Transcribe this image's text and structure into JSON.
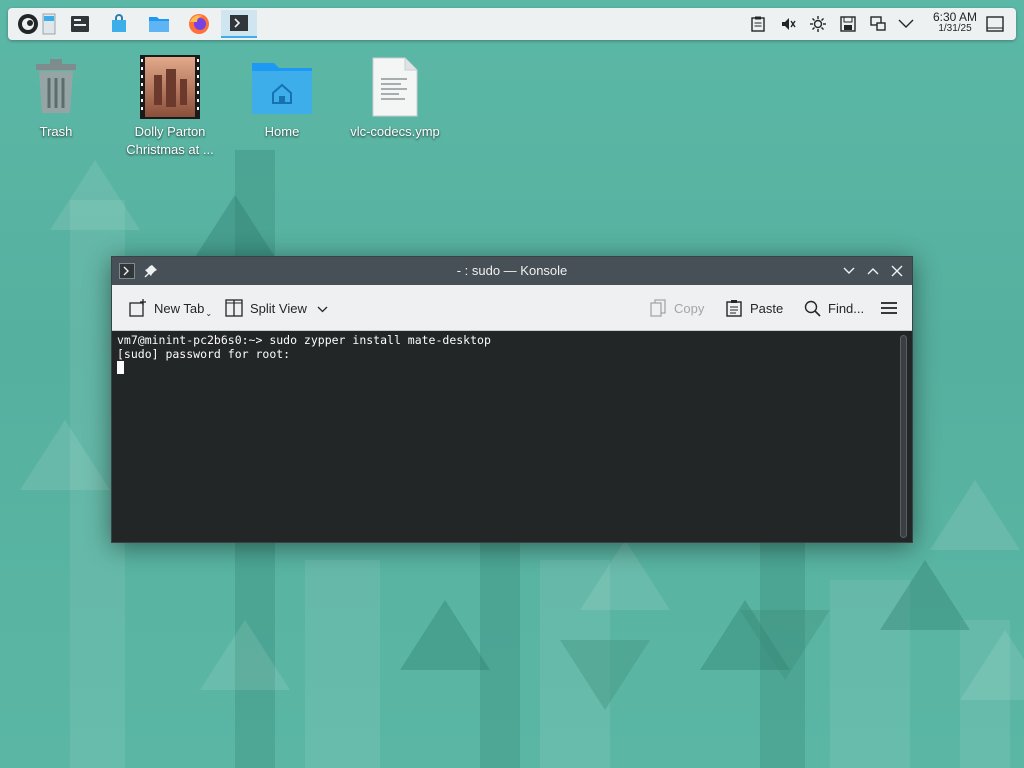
{
  "panel": {
    "clock_time": "6:30 AM",
    "clock_date": "1/31/25",
    "launchers": [
      "opensuse-logo-icon",
      "pager-icon",
      "task-manager-icon",
      "discover-store-icon",
      "dolphin-folder-icon",
      "firefox-icon",
      "konsole-icon"
    ],
    "tray": [
      "clipboard-icon",
      "volume-muted-icon",
      "brightness-icon",
      "save-disk-icon",
      "network-icon",
      "chevron-down-icon",
      "show-desktop-icon"
    ]
  },
  "desktop": {
    "icons": [
      {
        "label": "Trash",
        "icon": "trash-icon"
      },
      {
        "label": "Dolly Parton Christmas at ...",
        "icon": "video-thumbnail-icon"
      },
      {
        "label": "Home",
        "icon": "home-folder-icon"
      },
      {
        "label": "vlc-codecs.ymp",
        "icon": "text-file-icon"
      }
    ]
  },
  "konsole": {
    "title": "- : sudo — Konsole",
    "toolbar": {
      "new_tab": "New Tab",
      "split_view": "Split View",
      "copy": "Copy",
      "paste": "Paste",
      "find": "Find..."
    },
    "terminal": {
      "line1": "vm7@minint-pc2b6s0:~> sudo zypper install mate-desktop",
      "line2": "[sudo] password for root:"
    }
  },
  "colors": {
    "accent": "#3daee9",
    "desktop_bg": "#5cb8a6",
    "titlebar": "#475057",
    "terminal_bg": "#232627"
  }
}
